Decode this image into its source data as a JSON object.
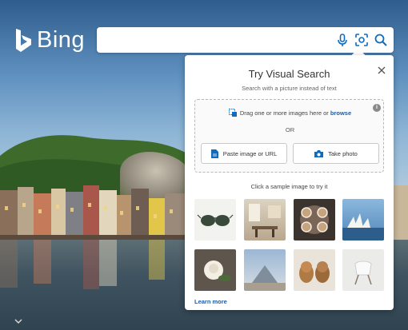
{
  "brand": {
    "logo_text": "Bing"
  },
  "search": {
    "placeholder": "",
    "value": ""
  },
  "search_icons": [
    "microphone-icon",
    "visual-search-icon",
    "search-icon"
  ],
  "visual_search": {
    "title": "Try Visual Search",
    "subtitle": "Search with a picture instead of text",
    "drag_text": "Drag one or more images here or",
    "browse_link": "browse",
    "or_text": "OR",
    "paste_button": "Paste image or URL",
    "photo_button": "Take photo",
    "sample_prompt": "Click a sample image to try it",
    "learn_more": "Learn more",
    "samples": [
      "sunglasses",
      "dining-room",
      "latte-cups",
      "sydney-opera-house",
      "white-rose",
      "louvre-pyramid",
      "puppies",
      "white-chair"
    ]
  },
  "colors": {
    "accent": "#1a5ea8",
    "icon_blue": "#0f6cbd"
  }
}
